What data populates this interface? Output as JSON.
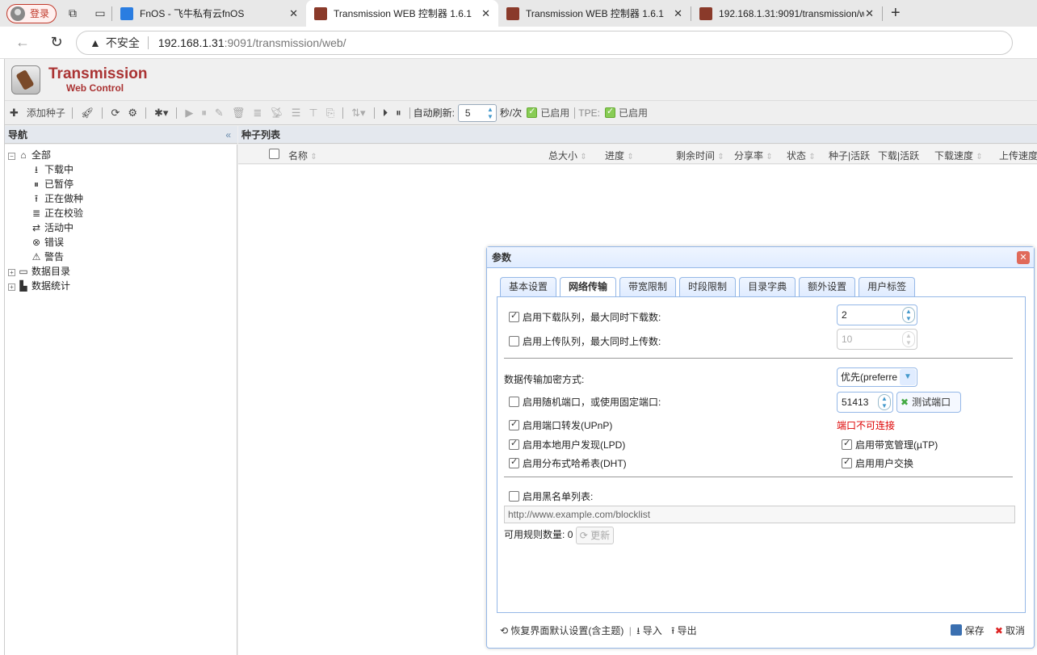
{
  "browser": {
    "login_label": "登录",
    "tabs": [
      {
        "title": "FnOS - 飞牛私有云fnOS"
      },
      {
        "title": "Transmission WEB 控制器 1.6.1"
      },
      {
        "title": "Transmission WEB 控制器 1.6.1"
      },
      {
        "title": "192.168.1.31:9091/transmission/w"
      }
    ],
    "insecure_label": "不安全",
    "url_host": "192.168.1.31",
    "url_path": ":9091/transmission/web/"
  },
  "app": {
    "logo_line1": "Transmission",
    "logo_line2": "Web Control",
    "toolbar": {
      "add_label": "添加种子",
      "autorefresh_label": "自动刷新:",
      "autorefresh_value": "5",
      "autorefresh_unit": "秒/次",
      "enabled_label": "已启用",
      "tpe_label": "TPE:",
      "tpe_enabled_label": "已启用"
    },
    "nav": {
      "header": "导航",
      "all": "全部",
      "items": [
        "下载中",
        "已暂停",
        "正在做种",
        "正在校验",
        "活动中",
        "错误",
        "警告"
      ],
      "data_dir": "数据目录",
      "stats": "数据统计"
    },
    "list": {
      "header": "种子列表",
      "columns": [
        "名称",
        "总大小",
        "进度",
        "剩余时间",
        "分享率",
        "状态",
        "种子|活跃",
        "下载|活跃",
        "下载速度",
        "上传速度"
      ]
    }
  },
  "dialog": {
    "title": "参数",
    "tabs": [
      "基本设置",
      "网络传输",
      "带宽限制",
      "时段限制",
      "目录字典",
      "额外设置",
      "用户标签"
    ],
    "download_queue_label": "启用下载队列，最大同时下载数:",
    "download_queue_value": "2",
    "upload_queue_label": "启用上传队列，最大同时上传数:",
    "upload_queue_value": "10",
    "encryption_label": "数据传输加密方式:",
    "encryption_value": "优先(preferre",
    "random_port_label": "启用随机端口，或使用固定端口:",
    "port_value": "51413",
    "test_port_label": "测试端口",
    "upnp_label": "启用端口转发(UPnP)",
    "port_status": "端口不可连接",
    "lpd_label": "启用本地用户发现(LPD)",
    "utp_label": "启用带宽管理(µTP)",
    "dht_label": "启用分布式哈希表(DHT)",
    "pex_label": "启用用户交换",
    "blocklist_label": "启用黑名单列表:",
    "blocklist_url": "http://www.example.com/blocklist",
    "rule_count_label": "可用规则数量:",
    "rule_count_value": "0",
    "update_label": "更新",
    "restore_label": "恢复界面默认设置(含主题)",
    "import_label": "导入",
    "export_label": "导出",
    "save_label": "保存",
    "cancel_label": "取消"
  }
}
